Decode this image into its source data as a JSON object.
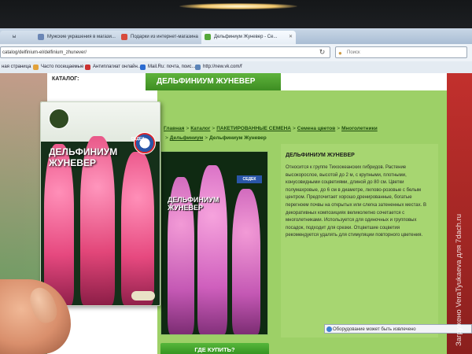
{
  "browser": {
    "tabs": [
      {
        "label": "ы"
      },
      {
        "label": "Мужские украшения в магази..."
      },
      {
        "label": "Подарки из интернет-магазина"
      },
      {
        "label": "Дельфиниум Жуневер - Се..."
      }
    ],
    "close_glyph": "✕",
    "url": "catalog/delfinium-el/delfinium_zhunever/",
    "search_placeholder": "Поиск",
    "bookmarks": [
      {
        "label": "ная страница"
      },
      {
        "label": "Часто посещаемые"
      },
      {
        "label": "Антиплагиат онлайн..."
      },
      {
        "label": "Mail.Ru: почта, поис..."
      },
      {
        "label": "http://new.vk.com/f"
      }
    ]
  },
  "page": {
    "catalog_label": "КАТАЛОГ:",
    "banner_title": "ДЕЛЬФИНИУМ ЖУНЕВЕР",
    "breadcrumb": [
      "Главная",
      "Каталог",
      "ПАКЕТИРОВАННЫЕ СЕМЕНА",
      "Семена цветов",
      "Многолетники",
      "Дельфиниум"
    ],
    "breadcrumb_tail": "Дельфиниум Жуневер",
    "breadcrumb_sep": ">",
    "pack_title_line1": "ДЕЛЬФИНИУМ",
    "pack_title_line2": "ЖУНЕВЕР",
    "brand": "СЕДЕК",
    "product_name": "ДЕЛЬФИНИУМ ЖУНЕВЕР",
    "description": "Относится к группе Тихоокеанских гибридов. Растение высокорослое, высотой до 2 м, с крупными, плотными, конусовидными соцветиями, длиной до 80 см. Цветки полумахровые, до 6 см в диаметре, лилово-розовые с белым центром. Предпочитает хорошо дренированные, богатые перегноем почвы на открытых или слегка затененных местах. В декоративных композициях великолепно сочетается с многолетниками. Используется для одиночных и групповых посадок, подходит для срезки. Отцветшие соцветия рекомендуется удалять для стимуляции повторного цветения.",
    "buy_button": "ГДЕ КУПИТЬ?",
    "notification": "Оборудование может быть извлечено"
  },
  "packet": {
    "title_line1": "ДЕЛЬФИНИУМ",
    "title_line2": "ЖУНЕВЕР",
    "brand": "СЕДЕК"
  },
  "watermark": "Загружено VeraTyukaeva для 7dach.ru",
  "colors": {
    "banner_green": "#4ea42e",
    "page_green": "#9dd067",
    "flower_pink": "#e6497f",
    "flower_lilac": "#d36bc2",
    "site_red": "#c2302d"
  }
}
